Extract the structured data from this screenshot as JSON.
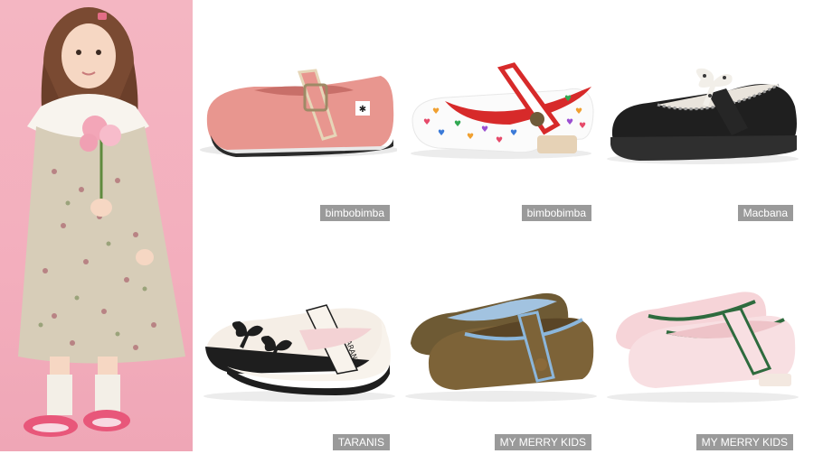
{
  "hero": {
    "icon": "girl-in-floral-dress-photo"
  },
  "products": [
    {
      "brand": "bimbobimba",
      "icon": "pink-linen-mary-jane-shoe"
    },
    {
      "brand": "bimbobimba",
      "icon": "white-heart-print-mary-jane-shoe"
    },
    {
      "brand": "Macbana",
      "icon": "black-leather-bow-shoe"
    },
    {
      "brand": "TARANIS",
      "icon": "white-ballet-bow-shoe"
    },
    {
      "brand": "MY MERRY KIDS",
      "icon": "olive-velvet-mary-jane-shoe"
    },
    {
      "brand": "MY MERRY KIDS",
      "icon": "pink-patent-mary-jane-shoe"
    }
  ],
  "brand_tag_color": "#9a9a9a"
}
